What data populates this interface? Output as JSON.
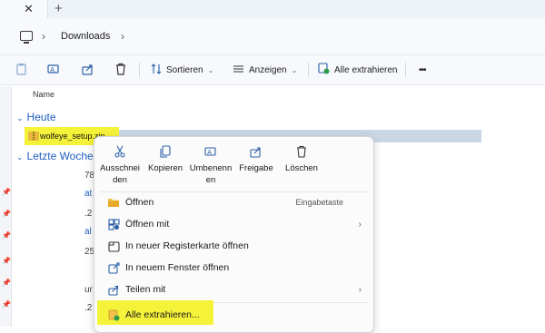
{
  "tabbar": {
    "close_glyph": "✕",
    "new_tab_glyph": "+"
  },
  "address": {
    "path": "Downloads",
    "sep": "›"
  },
  "toolbar": {
    "sort_label": "Sortieren",
    "view_label": "Anzeigen",
    "extract_all_label": "Alle extrahieren",
    "more_glyph": "•••"
  },
  "list": {
    "column_name": "Name",
    "group_today": "Heute",
    "group_last_week": "Letzte Woche",
    "file_name": "wolfeye_setup.zip",
    "fragments": [
      "78",
      "at",
      ".2",
      "al",
      "25",
      "ur",
      ".2"
    ]
  },
  "context_menu": {
    "quick_actions": [
      {
        "icon": "scissors-icon",
        "label": "Ausschnei den"
      },
      {
        "icon": "copy-icon",
        "label": "Kopieren"
      },
      {
        "icon": "rename-icon",
        "label": "Umbenenn en"
      },
      {
        "icon": "share-icon",
        "label": "Freigabe"
      },
      {
        "icon": "trash-icon",
        "label": "Löschen"
      }
    ],
    "items": [
      {
        "icon": "folder-icon",
        "label": "Öffnen",
        "hint": "Eingabetaste"
      },
      {
        "icon": "open-with-icon",
        "label": "Öffnen mit",
        "submenu": "›"
      },
      {
        "icon": "new-tab-icon",
        "label": "In neuer Registerkarte öffnen"
      },
      {
        "icon": "new-window-icon",
        "label": "In neuem Fenster öffnen"
      },
      {
        "icon": "share-icon",
        "label": "Teilen mit",
        "submenu": "›"
      },
      {
        "icon": "extract-icon",
        "label": "Alle extrahieren..."
      }
    ]
  },
  "colors": {
    "accent": "#1f5fbf",
    "highlight": "#f5f23a",
    "selection": "#ccd7e5"
  }
}
